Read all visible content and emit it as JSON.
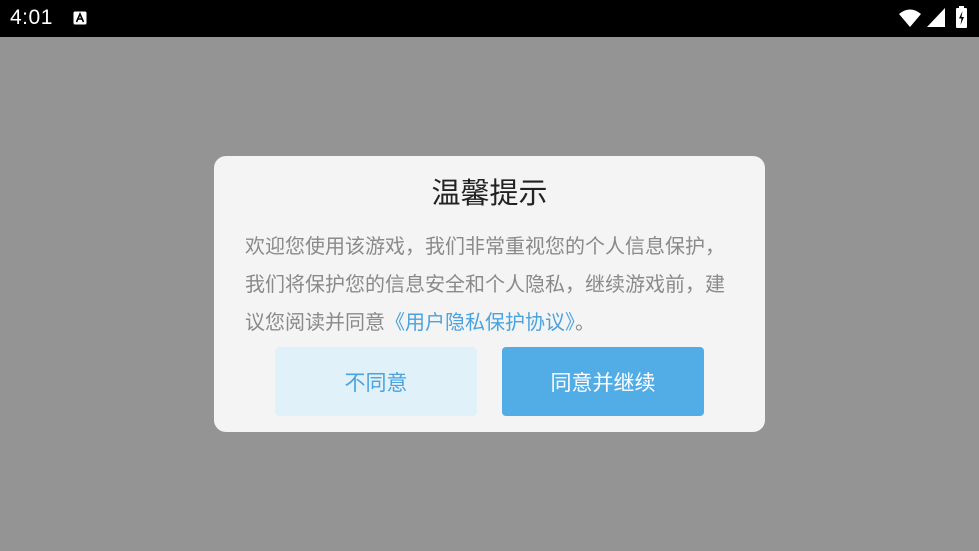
{
  "status_bar": {
    "time": "4:01",
    "icons": [
      "a-notification-icon",
      "wifi-icon",
      "signal-icon",
      "battery-charging-icon"
    ]
  },
  "dialog": {
    "title": "温馨提示",
    "message_prefix": "欢迎您使用该游戏，我们非常重视您的个人信息保护，我们将保护您的信息安全和个人隐私，继续游戏前，建议您阅读并同意",
    "privacy_link": "《用户隐私保护协议》",
    "message_suffix": "。",
    "buttons": {
      "disagree": "不同意",
      "agree": "同意并继续"
    }
  },
  "colors": {
    "backdrop": "#949494",
    "dialog_bg": "#f4f4f4",
    "link": "#4aa3df",
    "agree_bg": "#52ace6",
    "disagree_bg": "#e1f1fa"
  }
}
